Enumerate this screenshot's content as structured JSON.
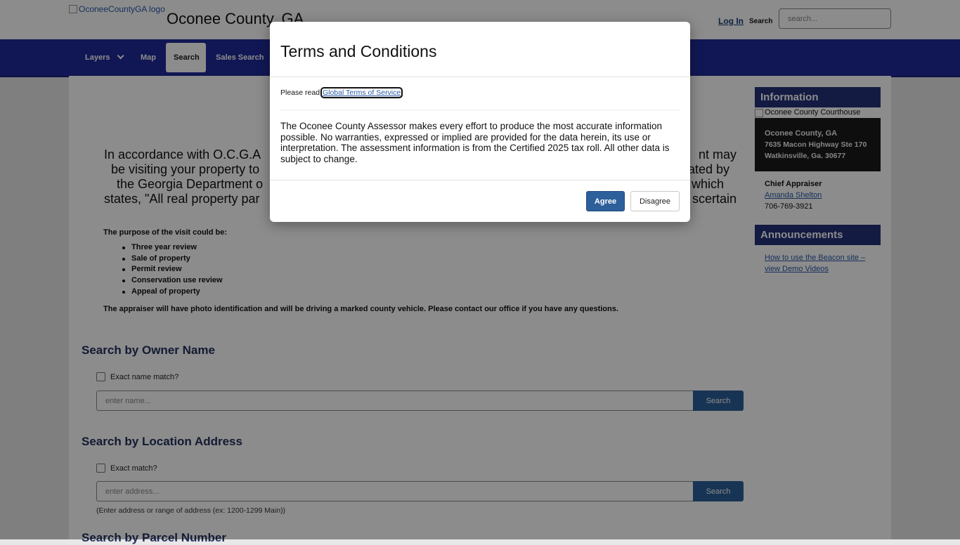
{
  "header": {
    "logo_alt": "OconeeCountyGA logo",
    "site_title": "Oconee County, GA",
    "login_label": "Log In",
    "search_label": "Search",
    "search_placeholder": "search..."
  },
  "nav": {
    "items": [
      {
        "label": "Layers"
      },
      {
        "label": "Map"
      },
      {
        "label": "Search"
      },
      {
        "label": "Sales Search"
      }
    ]
  },
  "notice": {
    "lines": [
      [
        "In accordance with O.C.G.A",
        "nt may"
      ],
      [
        "be visiting your property to",
        "ated by"
      ],
      [
        "the Georgia Department o",
        "which"
      ],
      [
        "states, \"All real property par",
        "scertain"
      ]
    ],
    "purpose_heading": "The purpose of the visit could be:",
    "purposes": [
      "Three year review",
      "Sale of property",
      "Permit review",
      "Conservation use review",
      "Appeal of property"
    ],
    "vehicle_text": "The appraiser will have photo identification and will be driving a marked county vehicle.  Please contact our office if you have any questions."
  },
  "owner_search": {
    "heading": "Search by Owner Name",
    "checkbox_label": "Exact name match?",
    "placeholder": "enter name...",
    "button": "Search"
  },
  "address_search": {
    "heading": "Search by Location Address",
    "checkbox_label": "Exact match?",
    "placeholder": "enter address...",
    "button": "Search",
    "hint": "(Enter address or range of address (ex: 1200-1299 Main))"
  },
  "parcel_search": {
    "heading": "Search by Parcel Number"
  },
  "sidebar": {
    "info_heading": "Information",
    "courthouse_alt": "Oconee County Courthouse",
    "office_name": "Oconee County, GA",
    "address_line1": "7635 Macon Highway Ste 170",
    "address_line2": "Watkinsville, Ga. 30677",
    "chief_label": "Chief Appraiser",
    "chief_name": "Amanda Shelton",
    "phone": "706-769-3921",
    "announcements_heading": "Announcements",
    "announcement_link": "How to use the Beacon site – view Demo Videos"
  },
  "modal": {
    "title": "Terms and Conditions",
    "please_read": "Please read",
    "tos_link": "Global Terms of Service",
    "disclaimer": "The Oconee County Assessor makes every effort to produce the most accurate information possible. No warranties, expressed or implied are provided for the data herein, its use or interpretation. The assessment information is from the Certified 2025 tax roll. All other data is subject to change.",
    "agree": "Agree",
    "disagree": "Disagree"
  }
}
